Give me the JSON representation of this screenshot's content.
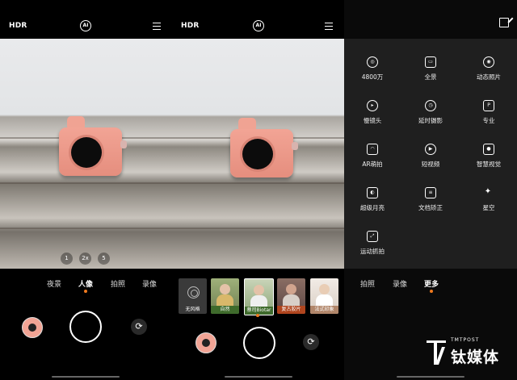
{
  "panel1": {
    "hdr": "HDR",
    "ai": "AI",
    "zoom_levels": [
      "1",
      "2x",
      "5"
    ],
    "modes": [
      {
        "label": "夜景",
        "active": false
      },
      {
        "label": "人像",
        "active": true
      },
      {
        "label": "拍照",
        "active": false
      },
      {
        "label": "录像",
        "active": false
      }
    ]
  },
  "panel2": {
    "hdr": "HDR",
    "ai": "AI",
    "filters": [
      {
        "label": "无风格",
        "selected": false
      },
      {
        "label": "自然",
        "selected": false
      },
      {
        "label": "蔡司Biotar",
        "selected": true
      },
      {
        "label": "复古胶片",
        "selected": false
      },
      {
        "label": "法式印象",
        "selected": false
      }
    ]
  },
  "panel3": {
    "grid": [
      {
        "label": "4800万",
        "icon": "4800-icon"
      },
      {
        "label": "全景",
        "icon": "panorama-icon"
      },
      {
        "label": "动态照片",
        "icon": "motion-photo-icon"
      },
      {
        "label": "慢镜头",
        "icon": "slow-motion-icon"
      },
      {
        "label": "延时摄影",
        "icon": "timelapse-icon"
      },
      {
        "label": "专业",
        "icon": "pro-icon"
      },
      {
        "label": "AR萌拍",
        "icon": "ar-icon"
      },
      {
        "label": "短视频",
        "icon": "short-video-icon"
      },
      {
        "label": "智慧视觉",
        "icon": "smart-vision-icon"
      },
      {
        "label": "超级月亮",
        "icon": "super-moon-icon"
      },
      {
        "label": "文档矫正",
        "icon": "document-icon"
      },
      {
        "label": "星空",
        "icon": "starry-sky-icon"
      },
      {
        "label": "运动抓拍",
        "icon": "sport-capture-icon"
      }
    ],
    "modes": [
      {
        "label": "拍照",
        "active": false
      },
      {
        "label": "录像",
        "active": false
      },
      {
        "label": "更多",
        "active": true
      }
    ]
  },
  "watermark": {
    "small": "TMTPOST",
    "big": "钛媒体"
  },
  "colors": {
    "accent": "#f07a1e",
    "subject": "#f2a495"
  }
}
